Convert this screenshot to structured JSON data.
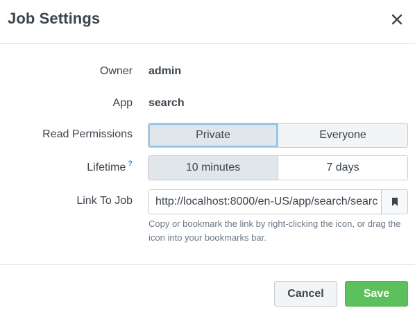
{
  "dialog": {
    "title": "Job Settings",
    "close_icon": "close-icon"
  },
  "fields": {
    "owner": {
      "label": "Owner",
      "value": "admin"
    },
    "app": {
      "label": "App",
      "value": "search"
    },
    "read_permissions": {
      "label": "Read Permissions",
      "options": [
        "Private",
        "Everyone"
      ],
      "selected": "Private"
    },
    "lifetime": {
      "label": "Lifetime",
      "help_marker": "?",
      "options": [
        "10 minutes",
        "7 days"
      ],
      "selected": "10 minutes"
    },
    "link_to_job": {
      "label": "Link To Job",
      "value": "http://localhost:8000/en-US/app/search/searc",
      "bookmark_icon": "bookmark-icon",
      "help_text": "Copy or bookmark the link by right-clicking the icon, or drag the icon into your bookmarks bar."
    }
  },
  "footer": {
    "cancel_label": "Cancel",
    "save_label": "Save"
  },
  "colors": {
    "save_green": "#5cc05c",
    "help_blue": "#1a9ad6",
    "focus_ring": "#8fc4e8"
  }
}
